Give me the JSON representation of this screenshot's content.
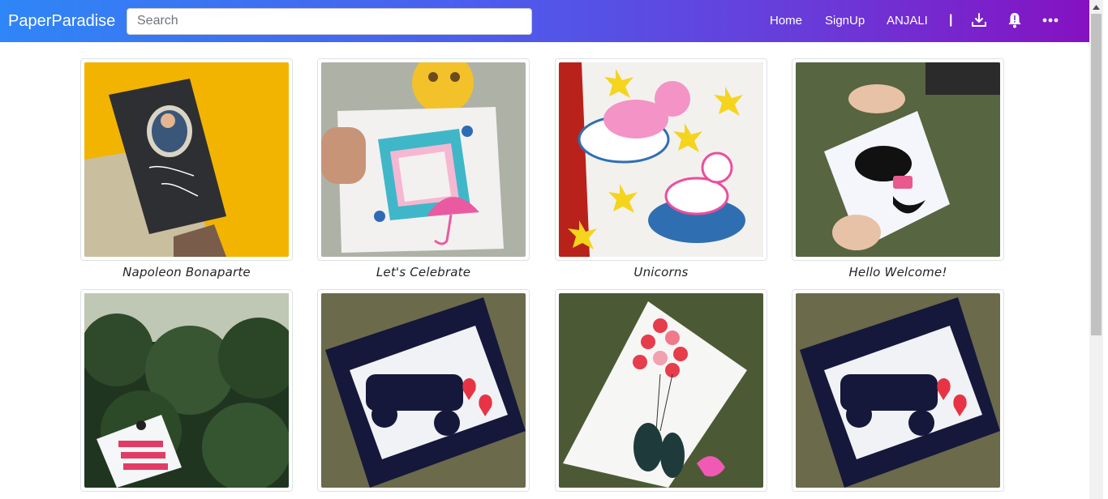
{
  "navbar": {
    "brand": "PaperParadise",
    "search_placeholder": "Search",
    "links": {
      "home": "Home",
      "signup": "SignUp",
      "user": "ANJALI",
      "separator": "|"
    },
    "icons": [
      "download-icon",
      "bell-icon",
      "more-icon"
    ]
  },
  "cards": [
    {
      "caption": "Napoleon Bonaparte"
    },
    {
      "caption": "Let's Celebrate"
    },
    {
      "caption": "Unicorns"
    },
    {
      "caption": "Hello Welcome!"
    },
    {
      "caption": ""
    },
    {
      "caption": ""
    },
    {
      "caption": ""
    },
    {
      "caption": ""
    }
  ],
  "colors": {
    "gradient_start": "#2f86f6",
    "gradient_end": "#8511c2",
    "caption_text": "#212529"
  }
}
